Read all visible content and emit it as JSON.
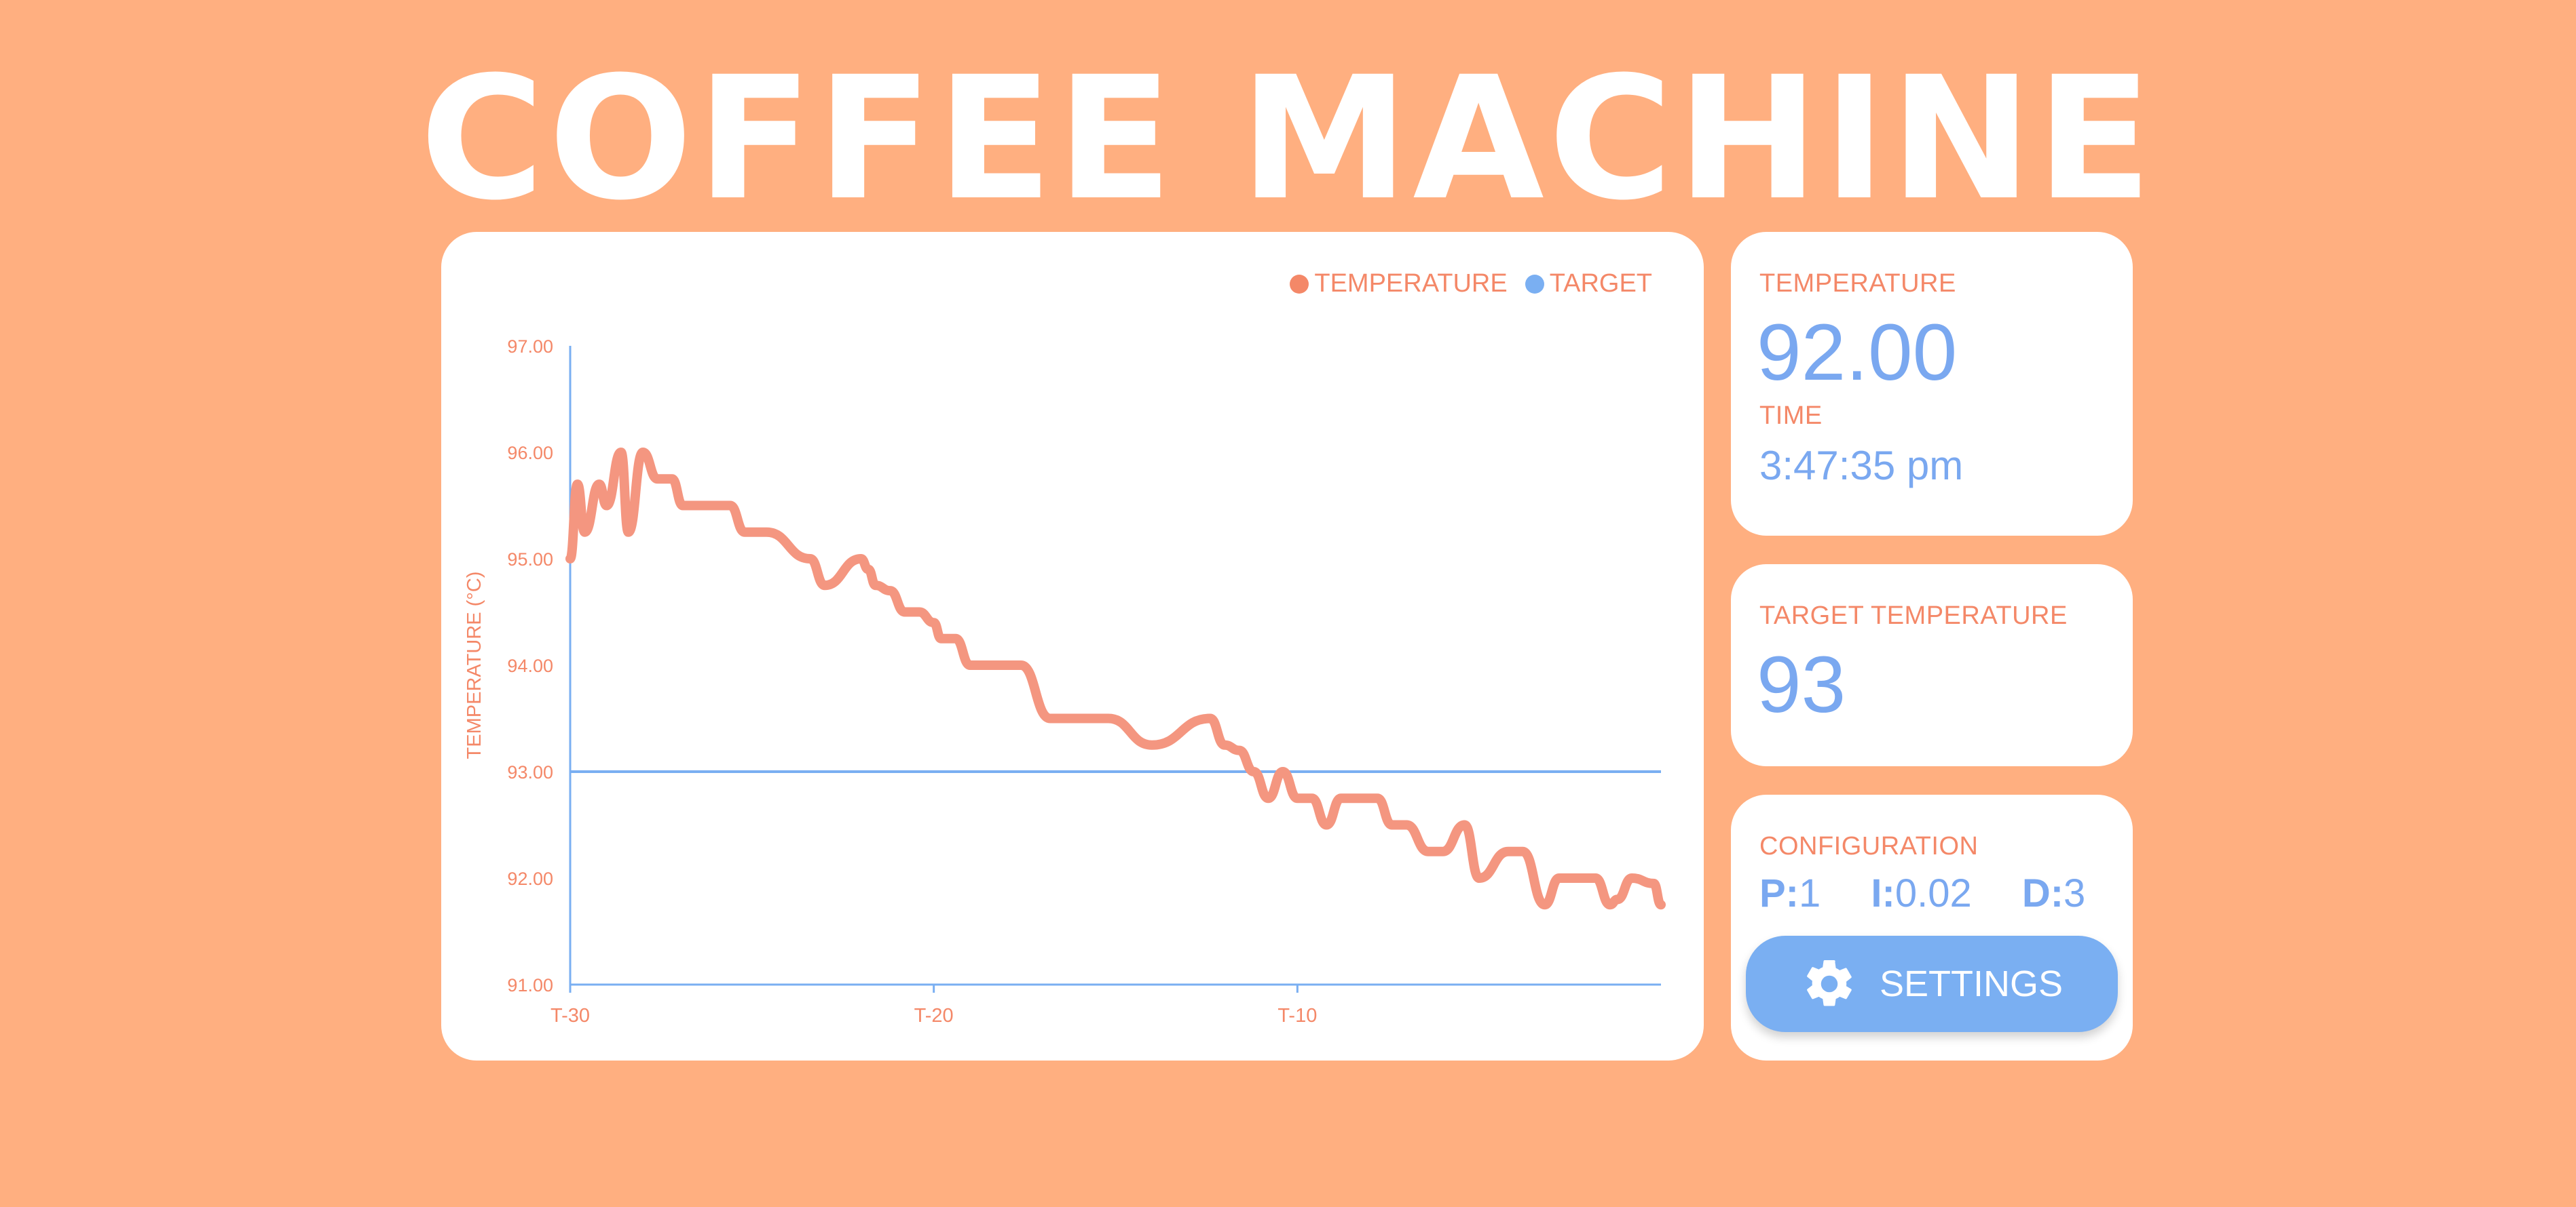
{
  "app": {
    "title": "COFFEE MACHINE"
  },
  "colors": {
    "background": "#FFAF80",
    "accent_orange": "#F48868",
    "accent_blue": "#7AA8F0",
    "temperature_line": "#F49680",
    "target_line": "#7AAFF2"
  },
  "temperature_card": {
    "temperature_label": "TEMPERATURE",
    "temperature_value": "92.00",
    "time_label": "TIME",
    "time_value": "3:47:35 pm"
  },
  "target_card": {
    "label": "TARGET TEMPERATURE",
    "value": "93"
  },
  "config_card": {
    "label": "CONFIGURATION",
    "p_key": "P:",
    "p_value": "1",
    "i_key": "I:",
    "i_value": "0.02",
    "d_key": "D:",
    "d_value": "3",
    "settings_label": "SETTINGS",
    "settings_icon": "gear-icon"
  },
  "chart_data": {
    "type": "line",
    "ylabel": "TEMPERATURE (°C)",
    "xlabel": "",
    "ylim": [
      91,
      97
    ],
    "y_ticks": [
      "91.00",
      "92.00",
      "93.00",
      "94.00",
      "95.00",
      "96.00",
      "97.00"
    ],
    "x_range": [
      -30,
      0
    ],
    "x_ticks": [
      {
        "x": -30,
        "label": "T-30"
      },
      {
        "x": -20,
        "label": "T-20"
      },
      {
        "x": -10,
        "label": "T-10"
      }
    ],
    "legend": [
      "TEMPERATURE",
      "TARGET"
    ],
    "legend_position": "top-right",
    "series": [
      {
        "name": "TEMPERATURE",
        "x": [
          -30,
          -29.8,
          -29.6,
          -29.2,
          -29,
          -28.6,
          -28.4,
          -28.0,
          -27.6,
          -27.2,
          -26.9,
          -26.6,
          -26.4,
          -26.0,
          -25.6,
          -25.2,
          -24.6,
          -23.4,
          -23.0,
          -22.0,
          -21.8,
          -21.6,
          -21.2,
          -20.8,
          -20.4,
          -20.0,
          -19.8,
          -19.4,
          -19.0,
          -18.4,
          -18.0,
          -17.6,
          -16.8,
          -15.6,
          -15.2,
          -14.0,
          -12.4,
          -12.0,
          -11.6,
          -11.2,
          -10.8,
          -10.4,
          -10.0,
          -9.6,
          -9.2,
          -8.8,
          -8.4,
          -7.8,
          -7.4,
          -7.0,
          -6.4,
          -6.0,
          -5.4,
          -5.0,
          -4.2,
          -3.8,
          -3.2,
          -2.8,
          -2.4,
          -1.8,
          -1.4,
          -1.2,
          -0.8,
          -0.2,
          0.0
        ],
        "y": [
          95.0,
          95.7,
          95.25,
          95.7,
          95.5,
          96.0,
          95.25,
          96.0,
          95.75,
          95.75,
          95.5,
          95.5,
          95.5,
          95.5,
          95.5,
          95.25,
          95.25,
          95.0,
          94.75,
          95.0,
          94.9,
          94.75,
          94.7,
          94.5,
          94.5,
          94.4,
          94.25,
          94.25,
          94.0,
          94.0,
          94.0,
          94.0,
          93.5,
          93.5,
          93.5,
          93.25,
          93.5,
          93.25,
          93.2,
          93.0,
          92.75,
          93.0,
          92.75,
          92.75,
          92.5,
          92.75,
          92.75,
          92.75,
          92.5,
          92.5,
          92.25,
          92.25,
          92.5,
          92.0,
          92.25,
          92.25,
          91.75,
          92.0,
          92.0,
          92.0,
          91.75,
          91.8,
          92.0,
          91.95,
          91.75
        ]
      },
      {
        "name": "TARGET",
        "x": [
          -30,
          0
        ],
        "y": [
          93,
          93
        ]
      }
    ]
  }
}
